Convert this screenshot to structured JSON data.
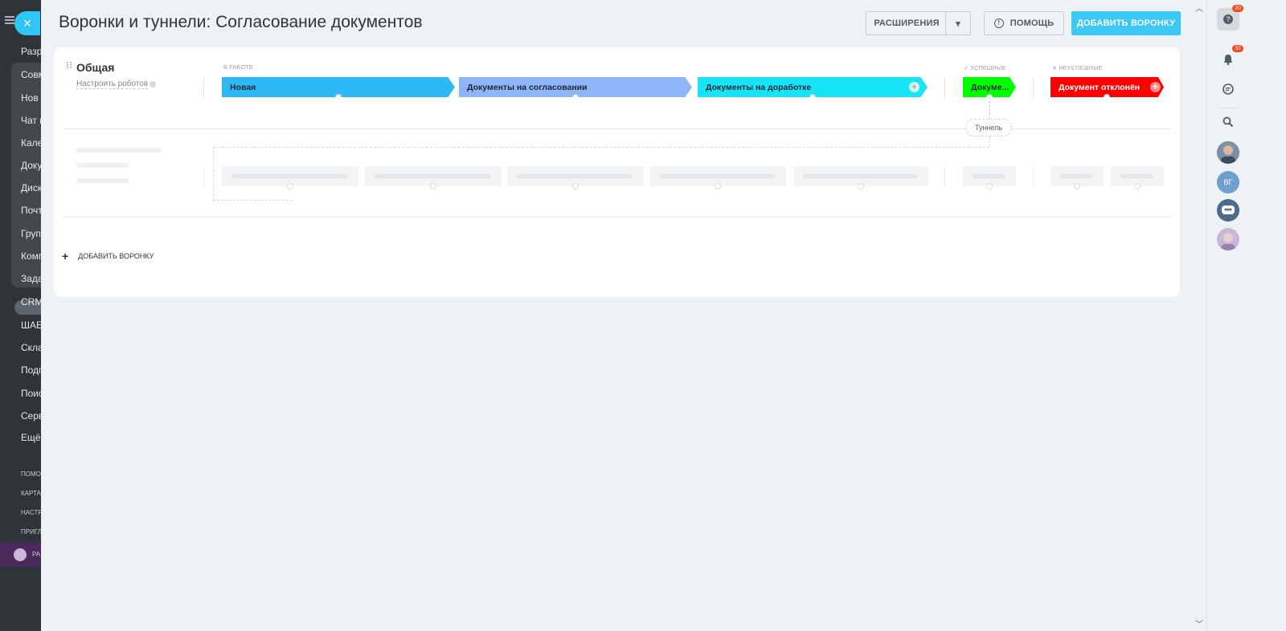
{
  "underlay": {
    "items": [
      "Разр",
      "Совм",
      "Нов",
      "Чат и",
      "Кале",
      "Доку",
      "Диск",
      "Почт",
      "Груп",
      "Комп",
      "Зада",
      "CRM",
      "ШАБ",
      "Скла",
      "Подп",
      "Поис",
      "Серв",
      "Ещё"
    ],
    "small_items": [
      "ПОМО",
      "КАРТА",
      "НАСТР",
      "ПРИГЛ"
    ],
    "bottom_item": "РА"
  },
  "close_icon": "×",
  "header": {
    "title": "Воронки и туннели: Согласование документов",
    "extensions_label": "Расширения",
    "extensions_arrow": "▾",
    "help_label": "Помощь",
    "help_icon": "!",
    "add_funnel_label": "Добавить воронку"
  },
  "funnel": {
    "name": "Общая",
    "robots_label": "Настроить роботов",
    "categories": {
      "in_work": "В работе",
      "success": "✓ Успешные",
      "fail": "✕ Неуспешные"
    },
    "stages": [
      {
        "label": "Новая",
        "color": "#2fb8f6"
      },
      {
        "label": "Документы на согласовании",
        "color": "#8eb5f8"
      },
      {
        "label": "Документы на доработке",
        "color": "#17e4f6"
      }
    ],
    "success_stage": {
      "label": "Докуме...",
      "color": "#00ff00"
    },
    "fail_stage": {
      "label": "Документ отклонён",
      "color": "#ff0000"
    },
    "stage_add_icon": "+",
    "tunnel_label": "Туннель"
  },
  "add_funnel_link": {
    "plus": "+",
    "label": "Добавить воронку"
  },
  "scroll": {
    "up": "︿",
    "down": "﹀"
  },
  "rightbar": {
    "help_badge": "20",
    "notify_badge": "32",
    "avatar_initials": "ВГ"
  }
}
